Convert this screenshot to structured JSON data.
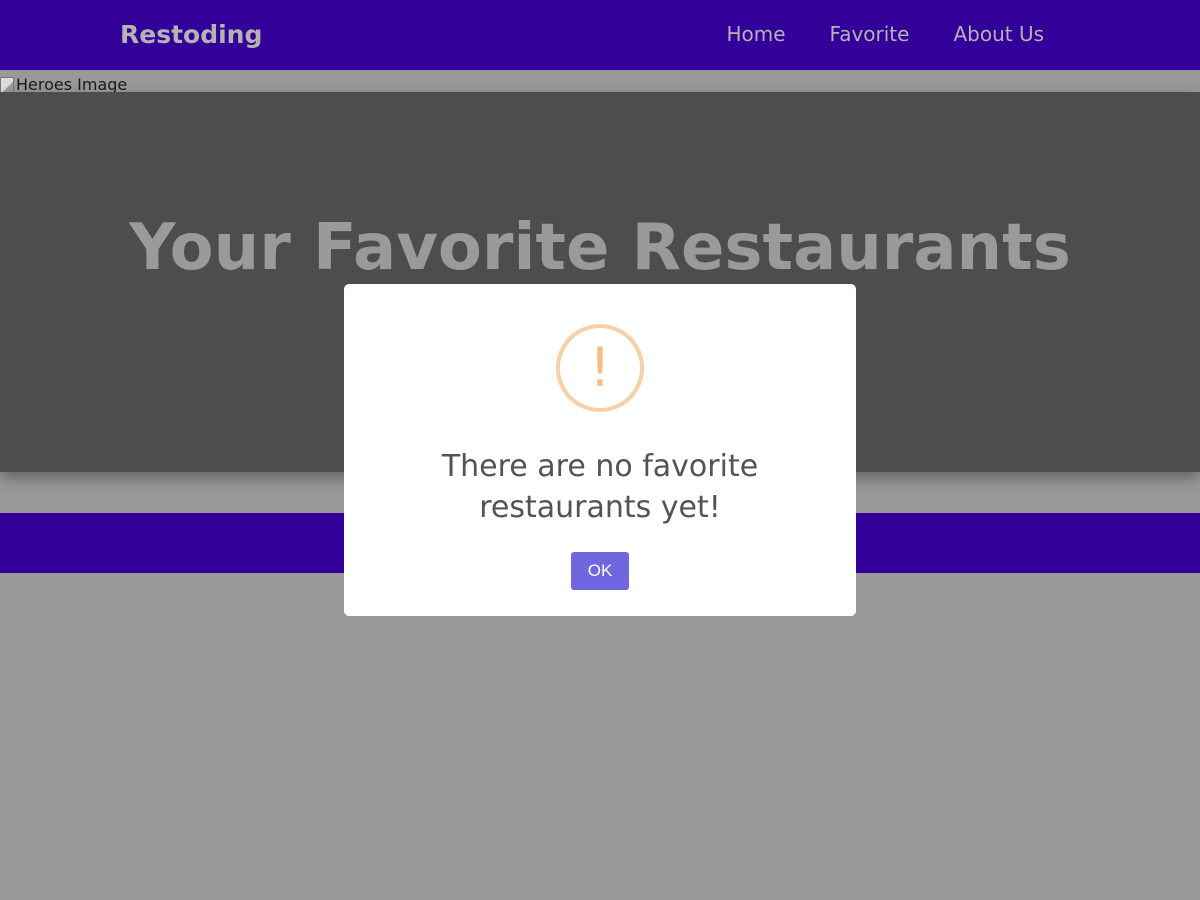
{
  "navbar": {
    "brand": "Restoding",
    "links": [
      {
        "label": "Home"
      },
      {
        "label": "Favorite"
      },
      {
        "label": "About Us"
      }
    ]
  },
  "hero": {
    "image_alt": "Heroes Image",
    "title": "Your Favorite Restaurants"
  },
  "modal": {
    "icon": "warning-exclamation-icon",
    "icon_glyph": "!",
    "message": "There are no favorite restaurants yet!",
    "confirm_label": "OK"
  },
  "colors": {
    "nav_bg": "#330099",
    "overlay_bg": "#999999",
    "button_bg": "#7066e0",
    "warning_icon": "#f8bb86"
  }
}
